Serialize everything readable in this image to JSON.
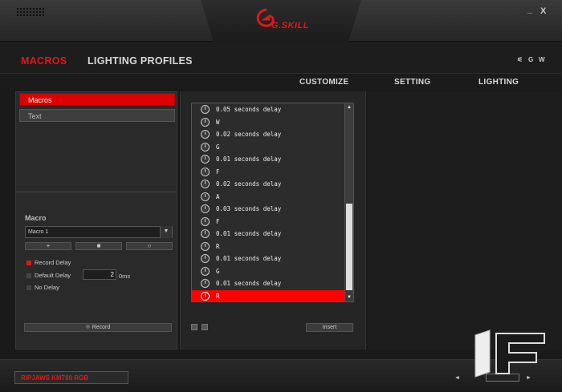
{
  "header": {
    "brand": "G.SKILL",
    "minimize": "_",
    "close": "X"
  },
  "nav": {
    "tabs": [
      {
        "label": "MACROS",
        "active": true
      },
      {
        "label": "LIGHTING PROFILES",
        "active": false
      }
    ],
    "lang_label": "G",
    "lang_label2": "W"
  },
  "subnav": [
    "CUSTOMIZE",
    "SETTING",
    "LIGHTING"
  ],
  "left": {
    "categories": [
      {
        "label": "Macros",
        "active": true
      },
      {
        "label": "Text",
        "active": false
      }
    ],
    "macro_label": "Macro",
    "macro_selected": "Macro 1",
    "buttons": [
      "+",
      "■",
      "○"
    ],
    "options": {
      "record_delay": "Record Delay",
      "default_delay": "Default Delay",
      "default_delay_value": "2",
      "default_delay_unit": "0ms",
      "no_delay": "No Delay"
    },
    "record": "Record"
  },
  "list": {
    "rows": [
      {
        "text": "0.05 seconds delay",
        "type": "delay"
      },
      {
        "text": "W",
        "type": "key"
      },
      {
        "text": "0.02 seconds delay",
        "type": "delay"
      },
      {
        "text": "G",
        "type": "key"
      },
      {
        "text": "0.01 seconds delay",
        "type": "delay"
      },
      {
        "text": "F",
        "type": "key"
      },
      {
        "text": "0.02 seconds delay",
        "type": "delay"
      },
      {
        "text": "A",
        "type": "key"
      },
      {
        "text": "0.03 seconds delay",
        "type": "delay"
      },
      {
        "text": "F",
        "type": "key"
      },
      {
        "text": "0.01 seconds delay",
        "type": "delay"
      },
      {
        "text": "R",
        "type": "key"
      },
      {
        "text": "0.01 seconds delay",
        "type": "delay"
      },
      {
        "text": "G",
        "type": "key"
      },
      {
        "text": "0.01 seconds delay",
        "type": "delay"
      },
      {
        "text": "R",
        "type": "key",
        "selected": true
      }
    ],
    "insert": "Insert"
  },
  "footer": {
    "model": "RIPJAWS KM780 RGB",
    "prev": "◄",
    "next": "►"
  },
  "colors": {
    "accent": "#e01818"
  }
}
